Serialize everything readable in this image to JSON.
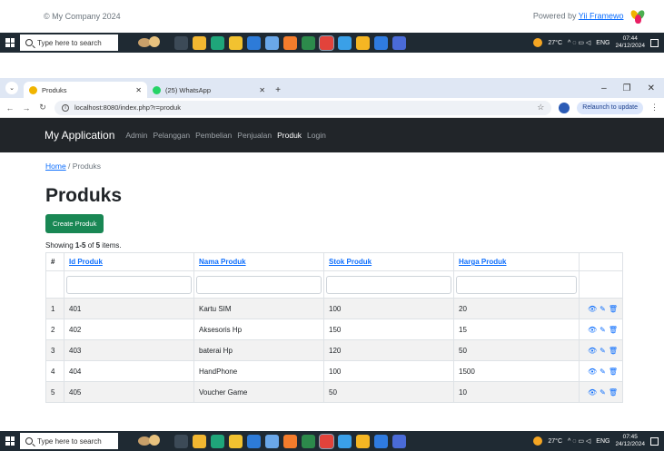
{
  "prev_footer": {
    "copyright": "© My Company 2024",
    "powered_prefix": "Powered by ",
    "powered_link": "Yii Framewo"
  },
  "taskbar": {
    "search_placeholder": "Type here to search",
    "temperature": "27°C",
    "language": "ENG",
    "time_top": "07:44",
    "date_top": "24/12/2024",
    "time_bottom": "07:45",
    "date_bottom": "24/12/2024"
  },
  "browser": {
    "tabs": [
      {
        "label": "Produks"
      },
      {
        "label": "(25) WhatsApp"
      }
    ],
    "url": "localhost:8080/index.php?r=produk",
    "relaunch_label": "Relaunch to update"
  },
  "navbar": {
    "brand": "My Application",
    "items": [
      {
        "label": "Admin"
      },
      {
        "label": "Pelanggan"
      },
      {
        "label": "Pembelian"
      },
      {
        "label": "Penjualan"
      },
      {
        "label": "Produk"
      },
      {
        "label": "Login"
      }
    ]
  },
  "breadcrumb": {
    "home": "Home",
    "separator": " / ",
    "current": "Produks"
  },
  "page": {
    "title": "Produks",
    "create_button": "Create Produk",
    "summary_prefix": "Showing ",
    "summary_range": "1-5",
    "summary_mid": " of ",
    "summary_total": "5",
    "summary_suffix": " items."
  },
  "table": {
    "headers": {
      "index": "#",
      "id": "Id Produk",
      "name": "Nama Produk",
      "stock": "Stok Produk",
      "price": "Harga Produk"
    },
    "rows": [
      {
        "n": "1",
        "id": "401",
        "name": "Kartu SIM",
        "stock": "100",
        "price": "20"
      },
      {
        "n": "2",
        "id": "402",
        "name": "Aksesoris Hp",
        "stock": "150",
        "price": "15"
      },
      {
        "n": "3",
        "id": "403",
        "name": "baterai Hp",
        "stock": "120",
        "price": "50"
      },
      {
        "n": "4",
        "id": "404",
        "name": "HandPhone",
        "stock": "100",
        "price": "1500"
      },
      {
        "n": "5",
        "id": "405",
        "name": "Voucher Game",
        "stock": "50",
        "price": "10"
      }
    ]
  }
}
